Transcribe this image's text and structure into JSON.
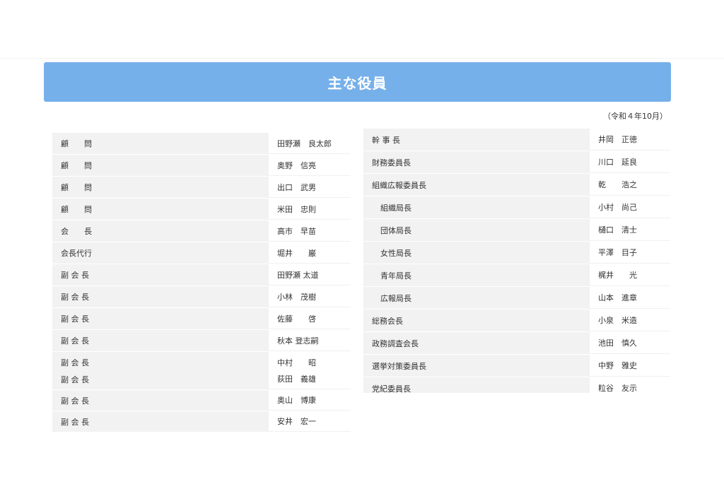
{
  "header": {
    "title": "主な役員"
  },
  "date_note": "（令和４年10月）",
  "left_table_a": [
    {
      "position": "顧　　問",
      "name": "田野瀬　良太郎"
    },
    {
      "position": "顧　　問",
      "name": "奥野　信亮"
    },
    {
      "position": "顧　　問",
      "name": "出口　武男"
    },
    {
      "position": "顧　　問",
      "name": "米田　忠則"
    },
    {
      "position": "会　　長",
      "name": "高市　早苗"
    },
    {
      "position": "会長代行",
      "name": "堀井　　巌"
    },
    {
      "position": "副 会 長",
      "name": "田野瀬 太道"
    },
    {
      "position": "副 会 長",
      "name": "小林　茂樹"
    },
    {
      "position": "副 会 長",
      "name": "佐藤　　啓"
    },
    {
      "position": "副 会 長",
      "name": "秋本 登志嗣"
    },
    {
      "position": "副 会 長",
      "name": "中村　　昭"
    }
  ],
  "left_table_b": [
    {
      "position": "副 会 長",
      "name": "荻田　義雄"
    },
    {
      "position": "副 会 長",
      "name": "奥山　博康"
    },
    {
      "position": "副 会 長",
      "name": "安井　宏一"
    }
  ],
  "right_table": [
    {
      "position": "幹 事 長",
      "name": "井岡　正徳",
      "indent": false
    },
    {
      "position": "財務委員長",
      "name": "川口　延良",
      "indent": false
    },
    {
      "position": "組織広報委員長",
      "name": "乾　　浩之",
      "indent": false
    },
    {
      "position": "組織局長",
      "name": "小村　尚己",
      "indent": true
    },
    {
      "position": "団体局長",
      "name": "樋口　清士",
      "indent": true
    },
    {
      "position": "女性局長",
      "name": "平澤　目子",
      "indent": true
    },
    {
      "position": "青年局長",
      "name": "梶井　　光",
      "indent": true
    },
    {
      "position": "広報局長",
      "name": "山本　進章",
      "indent": true
    },
    {
      "position": "総務会長",
      "name": "小泉　米造",
      "indent": false
    },
    {
      "position": "政務調査会長",
      "name": "池田　慎久",
      "indent": false
    },
    {
      "position": "選挙対策委員長",
      "name": "中野　雅史",
      "indent": false
    },
    {
      "position": "党紀委員長",
      "name": "粒谷　友示",
      "indent": false
    }
  ]
}
